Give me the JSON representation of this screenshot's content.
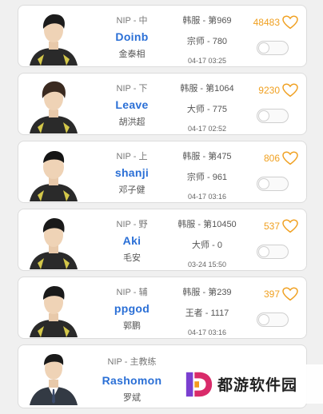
{
  "players": [
    {
      "team_pos": "NIP - 中",
      "nick": "Doinb",
      "real": "金泰相",
      "server_rank": "韩服 - 第969",
      "tier": "宗师 - 780",
      "time": "04-17 03:25",
      "likes": "48483"
    },
    {
      "team_pos": "NIP - 下",
      "nick": "Leave",
      "real": "胡洪超",
      "server_rank": "韩服 - 第1064",
      "tier": "大师 - 775",
      "time": "04-17 02:52",
      "likes": "9230"
    },
    {
      "team_pos": "NIP - 上",
      "nick": "shanji",
      "real": "邓子健",
      "server_rank": "韩服 - 第475",
      "tier": "宗师 - 961",
      "time": "04-17 03:16",
      "likes": "806"
    },
    {
      "team_pos": "NIP - 野",
      "nick": "Aki",
      "real": "毛安",
      "server_rank": "韩服 - 第10450",
      "tier": "大师 - 0",
      "time": "03-24 15:50",
      "likes": "537"
    },
    {
      "team_pos": "NIP - 辅",
      "nick": "ppgod",
      "real": "郭鹏",
      "server_rank": "韩服 - 第239",
      "tier": "王者 - 1117",
      "time": "04-17 03:16",
      "likes": "397"
    },
    {
      "team_pos": "NIP - 主教练",
      "nick": "Rashomon",
      "real": "罗斌"
    }
  ],
  "watermark": {
    "text": "都游软件园",
    "logo_letter": "D"
  },
  "colors": {
    "nick": "#2a6fd6",
    "likes": "#f0a020",
    "heart": "#f0a020",
    "logo": "#7a3fd0"
  }
}
